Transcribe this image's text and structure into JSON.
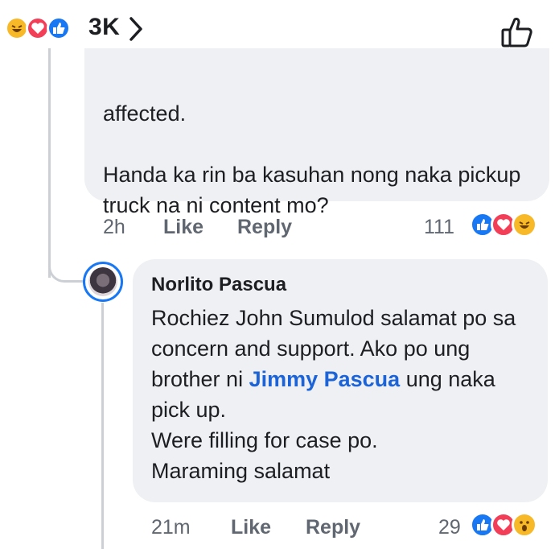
{
  "top_bar": {
    "reactions": [
      "laugh-reaction",
      "love-reaction",
      "like-reaction"
    ],
    "reaction_count": "3K",
    "chevron": ">",
    "like_icon": "thumbs-up-outline-icon"
  },
  "comment1": {
    "text_line1": "affected.",
    "text_para2": "Handa ka rin ba kasuhan nong naka pickup truck na ni content mo?",
    "time": "2h",
    "like_label": "Like",
    "reply_label": "Reply",
    "reaction_count": "111",
    "reactions": [
      "like-reaction",
      "love-reaction",
      "laugh-reaction"
    ]
  },
  "reply": {
    "author": "Norlito Pascua",
    "text_before_mention": "Rochiez John Sumulod salamat po sa concern and support.  Ako po ung brother ni ",
    "mention": "Jimmy Pascua",
    "text_after_mention": " ung naka pick up.",
    "line_filing": "Were filling for case po.",
    "line_thanks": "Maraming salamat",
    "time": "21m",
    "like_label": "Like",
    "reply_label": "Reply",
    "reaction_count": "29",
    "reactions": [
      "like-reaction",
      "love-reaction",
      "wow-reaction"
    ]
  },
  "colors": {
    "like_blue": "#1877f2",
    "love_red": "#f33e58",
    "haha_yellow": "#f7b928",
    "mention_blue": "#1b63d6",
    "bubble_gray": "#eef0f3"
  }
}
